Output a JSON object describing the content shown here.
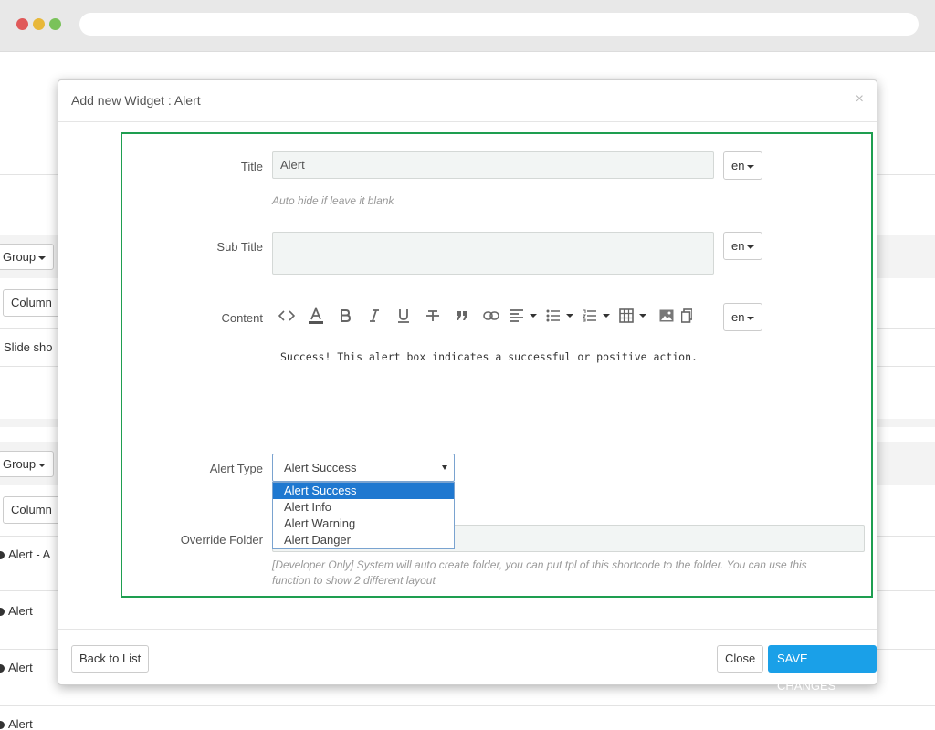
{
  "background": {
    "group_button_label": "Group",
    "column_button_label": "Column",
    "slide_text": "Slide sho",
    "rows": [
      "Alert - A",
      "Alert",
      "Alert",
      "Alert"
    ]
  },
  "modal": {
    "title": "Add new Widget : Alert",
    "close": "×",
    "fields": {
      "title_label": "Title",
      "title_value": "Alert",
      "title_hint": "Auto hide if leave it blank",
      "subtitle_label": "Sub Title",
      "subtitle_value": "",
      "content_label": "Content",
      "content_value": "Success! This alert box indicates a successful or positive action.",
      "alert_type_label": "Alert Type",
      "alert_type_selected": "Alert Success",
      "alert_type_options": [
        "Alert Success",
        "Alert Info",
        "Alert Warning",
        "Alert Danger"
      ],
      "override_folder_label": "Override Folder",
      "override_folder_hint_line1": "[Developer Only] System will auto create folder, you can put tpl of this shortcode to the folder. You can use this",
      "override_folder_hint_line2": "function to show 2 different layout"
    },
    "lang_label": "en",
    "toolbar_icons": [
      "code-view-icon",
      "font-color-icon",
      "bold-icon",
      "italic-icon",
      "underline-icon",
      "strikethrough-icon",
      "blockquote-icon",
      "link-icon",
      "align-icon",
      "unordered-list-icon",
      "ordered-list-icon",
      "table-icon",
      "image-icon",
      "copy-icon"
    ],
    "footer": {
      "back_label": "Back to List",
      "close_label": "Close",
      "save_label": "SAVE CHANGES"
    }
  },
  "colors": {
    "accent": "#1aa0e8",
    "highlight_border": "#1e9e50",
    "selected_option": "#1f78d0"
  }
}
